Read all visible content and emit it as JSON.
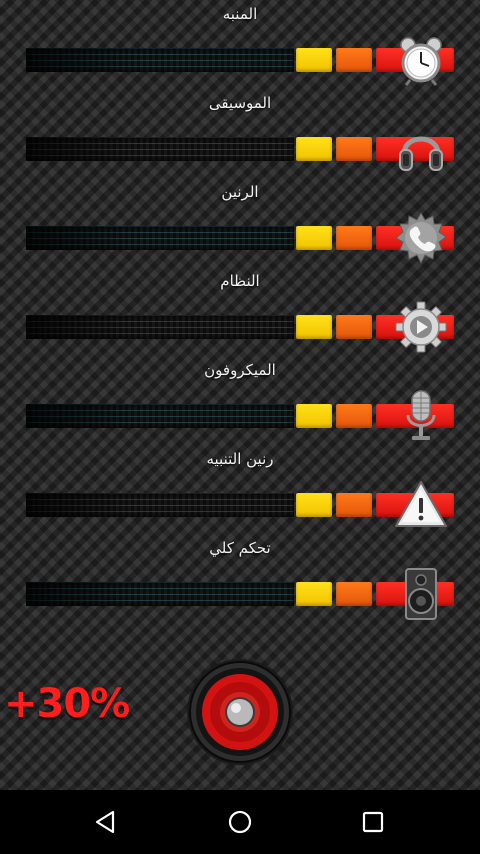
{
  "volume_rows": [
    {
      "label": "المنبه",
      "icon": "alarm-clock-icon"
    },
    {
      "label": "الموسيقى",
      "icon": "headphones-icon"
    },
    {
      "label": "الرنين",
      "icon": "phone-icon"
    },
    {
      "label": "النظام",
      "icon": "gear-icon"
    },
    {
      "label": "الميكروفون",
      "icon": "microphone-icon"
    },
    {
      "label": "رنين التنبيه",
      "icon": "warning-icon"
    },
    {
      "label": "تحكم كلي",
      "icon": "speaker-icon"
    }
  ],
  "boost": {
    "percent_label": "+30%",
    "icon": "big-speaker-icon"
  },
  "colors": {
    "segment_yellow": "#ffe11a",
    "segment_orange": "#ff7a1a",
    "segment_red": "#ff3024",
    "boost_text": "#ff1e1e"
  },
  "navbar": {
    "back_icon": "back-triangle-icon",
    "home_icon": "home-circle-icon",
    "recents_icon": "recents-square-icon"
  }
}
